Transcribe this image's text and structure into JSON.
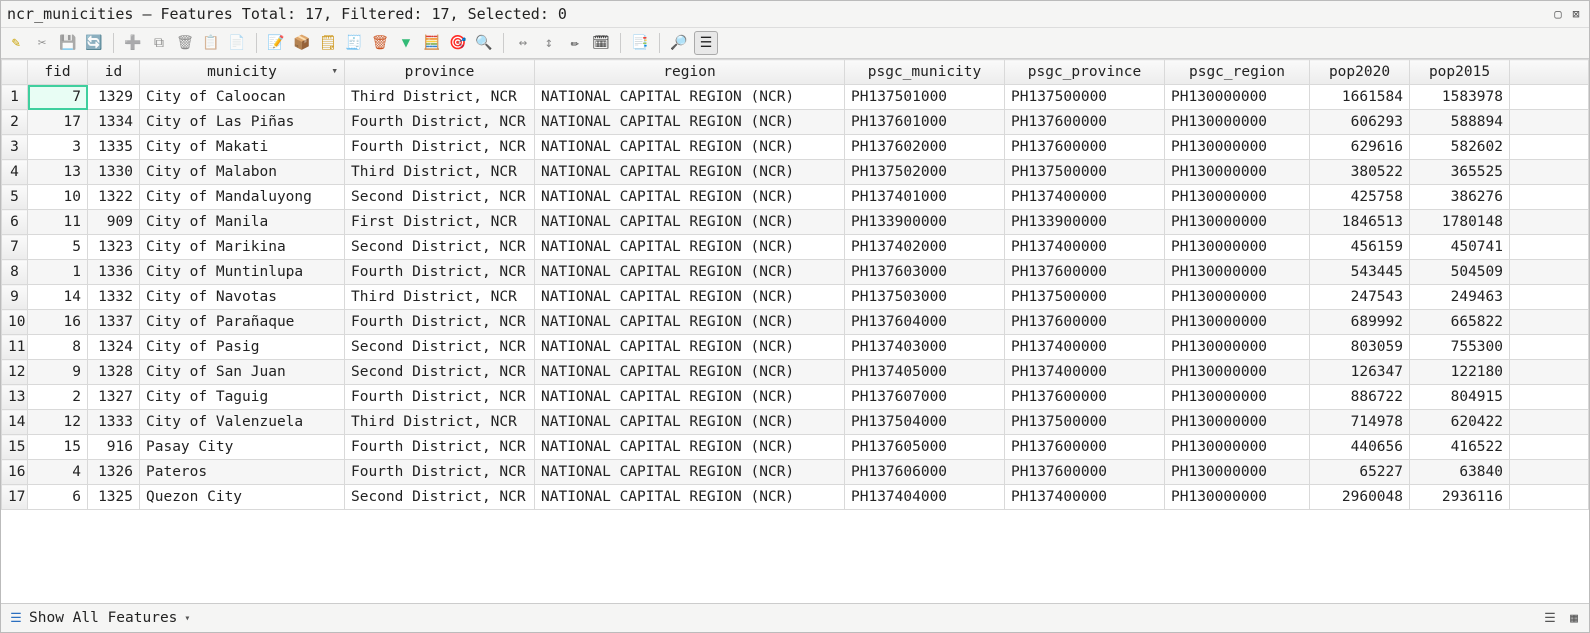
{
  "window": {
    "title": "ncr_municities — Features Total: 17, Filtered: 17, Selected: 0"
  },
  "toolbar_icons": {
    "i0": "✎",
    "i1": "✂",
    "i2": "💾",
    "i3": "🔄",
    "i4": "➕",
    "i5": "⧉",
    "i6": "🗑",
    "i7": "📋",
    "i8": "📄",
    "i9": "📝",
    "i10": "📦",
    "i11": "🗒",
    "i12": "🧾",
    "i13": "🗑",
    "i14": "▼",
    "i15": "🧮",
    "i16": "🎯",
    "i17": "🔍",
    "i18": "↔",
    "i19": "↕",
    "i20": "✏",
    "i21": "🗓",
    "i22": "📑",
    "i23": "🔎",
    "i24": "☰"
  },
  "columns": {
    "rowhdr": "",
    "fid": "fid",
    "id": "id",
    "municity": "municity",
    "province": "province",
    "region": "region",
    "psgc_m": "psgc_municity",
    "psgc_p": "psgc_province",
    "psgc_r": "psgc_region",
    "p2020": "pop2020",
    "p2015": "pop2015"
  },
  "rows": [
    {
      "n": "1",
      "fid": "7",
      "id": "1329",
      "municity": "City of Caloocan",
      "province": "Third District, NCR",
      "region": "NATIONAL CAPITAL REGION (NCR)",
      "psgc_m": "PH137501000",
      "psgc_p": "PH137500000",
      "psgc_r": "PH130000000",
      "p2020": "1661584",
      "p2015": "1583978"
    },
    {
      "n": "2",
      "fid": "17",
      "id": "1334",
      "municity": "City of Las Piñas",
      "province": "Fourth District, NCR",
      "region": "NATIONAL CAPITAL REGION (NCR)",
      "psgc_m": "PH137601000",
      "psgc_p": "PH137600000",
      "psgc_r": "PH130000000",
      "p2020": "606293",
      "p2015": "588894"
    },
    {
      "n": "3",
      "fid": "3",
      "id": "1335",
      "municity": "City of Makati",
      "province": "Fourth District, NCR",
      "region": "NATIONAL CAPITAL REGION (NCR)",
      "psgc_m": "PH137602000",
      "psgc_p": "PH137600000",
      "psgc_r": "PH130000000",
      "p2020": "629616",
      "p2015": "582602"
    },
    {
      "n": "4",
      "fid": "13",
      "id": "1330",
      "municity": "City of Malabon",
      "province": "Third District, NCR",
      "region": "NATIONAL CAPITAL REGION (NCR)",
      "psgc_m": "PH137502000",
      "psgc_p": "PH137500000",
      "psgc_r": "PH130000000",
      "p2020": "380522",
      "p2015": "365525"
    },
    {
      "n": "5",
      "fid": "10",
      "id": "1322",
      "municity": "City of Mandaluyong",
      "province": "Second District, NCR",
      "region": "NATIONAL CAPITAL REGION (NCR)",
      "psgc_m": "PH137401000",
      "psgc_p": "PH137400000",
      "psgc_r": "PH130000000",
      "p2020": "425758",
      "p2015": "386276"
    },
    {
      "n": "6",
      "fid": "11",
      "id": "909",
      "municity": "City of Manila",
      "province": "First District, NCR",
      "region": "NATIONAL CAPITAL REGION (NCR)",
      "psgc_m": "PH133900000",
      "psgc_p": "PH133900000",
      "psgc_r": "PH130000000",
      "p2020": "1846513",
      "p2015": "1780148"
    },
    {
      "n": "7",
      "fid": "5",
      "id": "1323",
      "municity": "City of Marikina",
      "province": "Second District, NCR",
      "region": "NATIONAL CAPITAL REGION (NCR)",
      "psgc_m": "PH137402000",
      "psgc_p": "PH137400000",
      "psgc_r": "PH130000000",
      "p2020": "456159",
      "p2015": "450741"
    },
    {
      "n": "8",
      "fid": "1",
      "id": "1336",
      "municity": "City of Muntinlupa",
      "province": "Fourth District, NCR",
      "region": "NATIONAL CAPITAL REGION (NCR)",
      "psgc_m": "PH137603000",
      "psgc_p": "PH137600000",
      "psgc_r": "PH130000000",
      "p2020": "543445",
      "p2015": "504509"
    },
    {
      "n": "9",
      "fid": "14",
      "id": "1332",
      "municity": "City of Navotas",
      "province": "Third District, NCR",
      "region": "NATIONAL CAPITAL REGION (NCR)",
      "psgc_m": "PH137503000",
      "psgc_p": "PH137500000",
      "psgc_r": "PH130000000",
      "p2020": "247543",
      "p2015": "249463"
    },
    {
      "n": "10",
      "fid": "16",
      "id": "1337",
      "municity": "City of Parañaque",
      "province": "Fourth District, NCR",
      "region": "NATIONAL CAPITAL REGION (NCR)",
      "psgc_m": "PH137604000",
      "psgc_p": "PH137600000",
      "psgc_r": "PH130000000",
      "p2020": "689992",
      "p2015": "665822"
    },
    {
      "n": "11",
      "fid": "8",
      "id": "1324",
      "municity": "City of Pasig",
      "province": "Second District, NCR",
      "region": "NATIONAL CAPITAL REGION (NCR)",
      "psgc_m": "PH137403000",
      "psgc_p": "PH137400000",
      "psgc_r": "PH130000000",
      "p2020": "803059",
      "p2015": "755300"
    },
    {
      "n": "12",
      "fid": "9",
      "id": "1328",
      "municity": "City of San Juan",
      "province": "Second District, NCR",
      "region": "NATIONAL CAPITAL REGION (NCR)",
      "psgc_m": "PH137405000",
      "psgc_p": "PH137400000",
      "psgc_r": "PH130000000",
      "p2020": "126347",
      "p2015": "122180"
    },
    {
      "n": "13",
      "fid": "2",
      "id": "1327",
      "municity": "City of Taguig",
      "province": "Fourth District, NCR",
      "region": "NATIONAL CAPITAL REGION (NCR)",
      "psgc_m": "PH137607000",
      "psgc_p": "PH137600000",
      "psgc_r": "PH130000000",
      "p2020": "886722",
      "p2015": "804915"
    },
    {
      "n": "14",
      "fid": "12",
      "id": "1333",
      "municity": "City of Valenzuela",
      "province": "Third District, NCR",
      "region": "NATIONAL CAPITAL REGION (NCR)",
      "psgc_m": "PH137504000",
      "psgc_p": "PH137500000",
      "psgc_r": "PH130000000",
      "p2020": "714978",
      "p2015": "620422"
    },
    {
      "n": "15",
      "fid": "15",
      "id": "916",
      "municity": "Pasay City",
      "province": "Fourth District, NCR",
      "region": "NATIONAL CAPITAL REGION (NCR)",
      "psgc_m": "PH137605000",
      "psgc_p": "PH137600000",
      "psgc_r": "PH130000000",
      "p2020": "440656",
      "p2015": "416522"
    },
    {
      "n": "16",
      "fid": "4",
      "id": "1326",
      "municity": "Pateros",
      "province": "Fourth District, NCR",
      "region": "NATIONAL CAPITAL REGION (NCR)",
      "psgc_m": "PH137606000",
      "psgc_p": "PH137600000",
      "psgc_r": "PH130000000",
      "p2020": "65227",
      "p2015": "63840"
    },
    {
      "n": "17",
      "fid": "6",
      "id": "1325",
      "municity": "Quezon City",
      "province": "Second District, NCR",
      "region": "NATIONAL CAPITAL REGION (NCR)",
      "psgc_m": "PH137404000",
      "psgc_p": "PH137400000",
      "psgc_r": "PH130000000",
      "p2020": "2960048",
      "p2015": "2936116"
    }
  ],
  "statusbar": {
    "filter_label": "Show All Features",
    "filter_icon": "☰"
  }
}
